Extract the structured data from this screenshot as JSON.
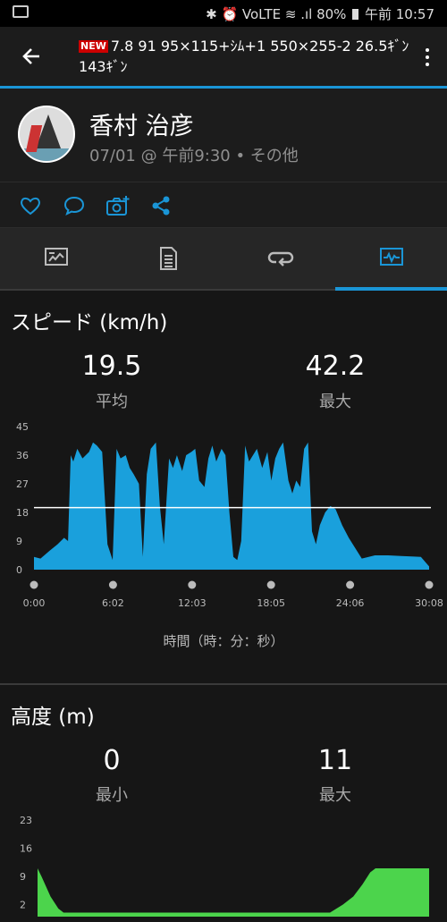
{
  "status_bar": {
    "indicators_text": "✱ ⏰ VoLTE ≋ .ıl",
    "battery": "80%",
    "time": "午前 10:57"
  },
  "app_bar": {
    "new_badge": "NEW",
    "title": "7.8 91 95×115+ｼﾑ+1 550×255-2 26.5ｷﾞﾝ143ｷﾞﾝ"
  },
  "profile": {
    "name": "香村 治彦",
    "meta": "07/01 @ 午前9:30 • その他"
  },
  "tabs": [
    {
      "icon": "overview-icon"
    },
    {
      "icon": "details-icon"
    },
    {
      "icon": "laps-icon"
    },
    {
      "icon": "charts-icon",
      "active": true
    }
  ],
  "speed_section": {
    "title": "スピード (km/h)",
    "avg_value": "19.5",
    "avg_label": "平均",
    "max_value": "42.2",
    "max_label": "最大",
    "x_axis_title": "時間（時：分：秒）"
  },
  "altitude_section": {
    "title": "高度 (m)",
    "min_value": "0",
    "min_label": "最小",
    "max_value": "11",
    "max_label": "最大"
  },
  "colors": {
    "accent": "#1a95d6",
    "speed_fill": "#1aa0dc",
    "altitude_fill": "#4cd44c"
  },
  "chart_data": [
    {
      "type": "area",
      "xlabel": "時間（時：分：秒）",
      "ylabel": "",
      "y_ticks": [
        "45",
        "36",
        "27",
        "18",
        "9",
        "0"
      ],
      "ylim": [
        0,
        45
      ],
      "x_ticks": [
        "0:00",
        "6:02",
        "12:03",
        "18:05",
        "24:06",
        "30:08"
      ],
      "xlim": [
        0,
        30.13
      ],
      "x_unit": "minutes",
      "reference_line": 19.5,
      "series": [
        {
          "x": [
            0,
            0.5,
            1.2,
            1.8,
            2.3,
            2.6,
            2.8,
            3.0,
            3.3,
            3.7,
            4.2,
            4.5,
            4.8,
            5.2,
            5.6,
            6.0,
            6.3,
            6.6,
            7.0,
            7.3,
            7.6,
            8.0,
            8.3,
            8.6,
            8.9,
            9.3,
            9.6,
            9.9,
            10.3,
            10.6,
            10.9,
            11.3,
            11.6,
            12.0,
            12.3,
            12.6,
            13.0,
            13.3,
            13.6,
            13.9,
            14.3,
            14.6,
            14.9,
            15.2,
            15.5,
            15.8,
            16.1,
            16.4,
            16.7,
            17.0,
            17.4,
            17.8,
            18.1,
            18.4,
            18.7,
            19.0,
            19.4,
            19.7,
            20.0,
            20.3,
            20.6,
            20.9,
            21.2,
            21.5,
            21.8,
            22.2,
            22.6,
            23.0,
            23.5,
            24.0,
            25.0,
            26.0,
            27.0,
            28.0,
            29.0,
            29.5,
            30.13
          ],
          "y": [
            4,
            3.5,
            6,
            8,
            10,
            9,
            36,
            34,
            38,
            35,
            37,
            40,
            39,
            37,
            8,
            3,
            38,
            35,
            36,
            32,
            30,
            27,
            4,
            30,
            38,
            40,
            20,
            8,
            35,
            32,
            36,
            31,
            36,
            37,
            38,
            28,
            26,
            35,
            39,
            34,
            38,
            36,
            18,
            4,
            3,
            9,
            39,
            34,
            36,
            38,
            32,
            37,
            28,
            35,
            38,
            40,
            28,
            24,
            28,
            26,
            38,
            40,
            12,
            8,
            14,
            18,
            20,
            19,
            14,
            10,
            3.5,
            4.5,
            4.5,
            4.3,
            4.1,
            4,
            1
          ]
        }
      ]
    },
    {
      "type": "area",
      "xlabel": "",
      "ylabel": "",
      "y_ticks": [
        "23",
        "16",
        "9",
        "2"
      ],
      "ylim": [
        -1,
        23
      ],
      "xlim": [
        0,
        30.13
      ],
      "x_unit": "minutes",
      "series": [
        {
          "x": [
            0,
            0.3,
            1.0,
            1.6,
            2.0,
            5,
            10,
            15,
            20,
            21.5,
            22.5,
            23.5,
            24.3,
            25,
            25.6,
            26,
            27,
            28,
            30.13
          ],
          "y": [
            11,
            9,
            4,
            1,
            0,
            0,
            0,
            0,
            0,
            0,
            0,
            2,
            4,
            7,
            10,
            11,
            11,
            11,
            11
          ]
        }
      ]
    }
  ]
}
